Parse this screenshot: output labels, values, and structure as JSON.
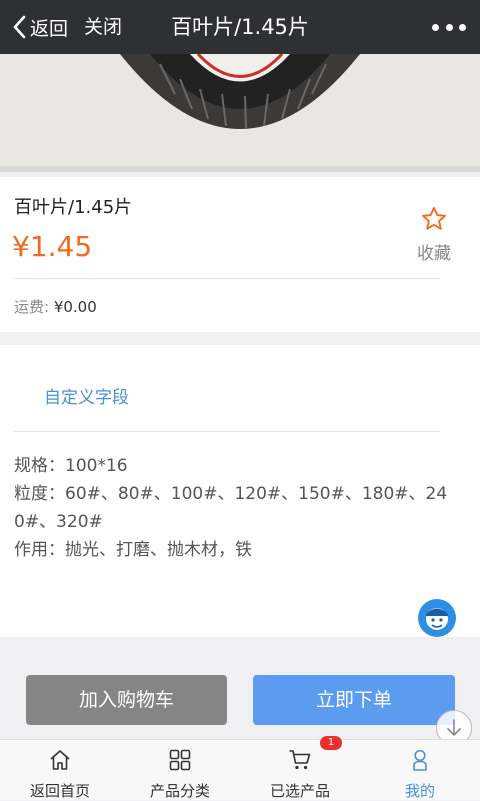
{
  "navbar": {
    "back_label": "返回",
    "close_label": "关闭",
    "title": "百叶片/1.45片"
  },
  "product": {
    "name": "百叶片/1.45片",
    "price": "¥1.45",
    "favorite_label": "收藏",
    "shipping_label": "运费: ",
    "shipping_value": "¥0.00"
  },
  "detail": {
    "custom_field_label": "自定义字段",
    "specs": [
      "规格：100*16",
      "粒度：60#、80#、100#、120#、150#、180#、240#、320#",
      "作用：抛光、打磨、抛木材，铁"
    ]
  },
  "actions": {
    "add_to_cart": "加入购物车",
    "buy_now": "立即下单"
  },
  "tabbar": {
    "items": [
      {
        "label": "返回首页",
        "icon": "home-icon"
      },
      {
        "label": "产品分类",
        "icon": "grid-icon"
      },
      {
        "label": "已选产品",
        "icon": "cart-icon"
      },
      {
        "label": "我的",
        "icon": "user-icon"
      }
    ],
    "cart_badge": "1",
    "active_index": 3
  },
  "colors": {
    "navbar": "#2f3033",
    "price": "#f26b1d",
    "accent": "#4a90d9",
    "buy_button": "#5b9cf0",
    "cart_button": "#858585",
    "badge": "#e9302a"
  }
}
